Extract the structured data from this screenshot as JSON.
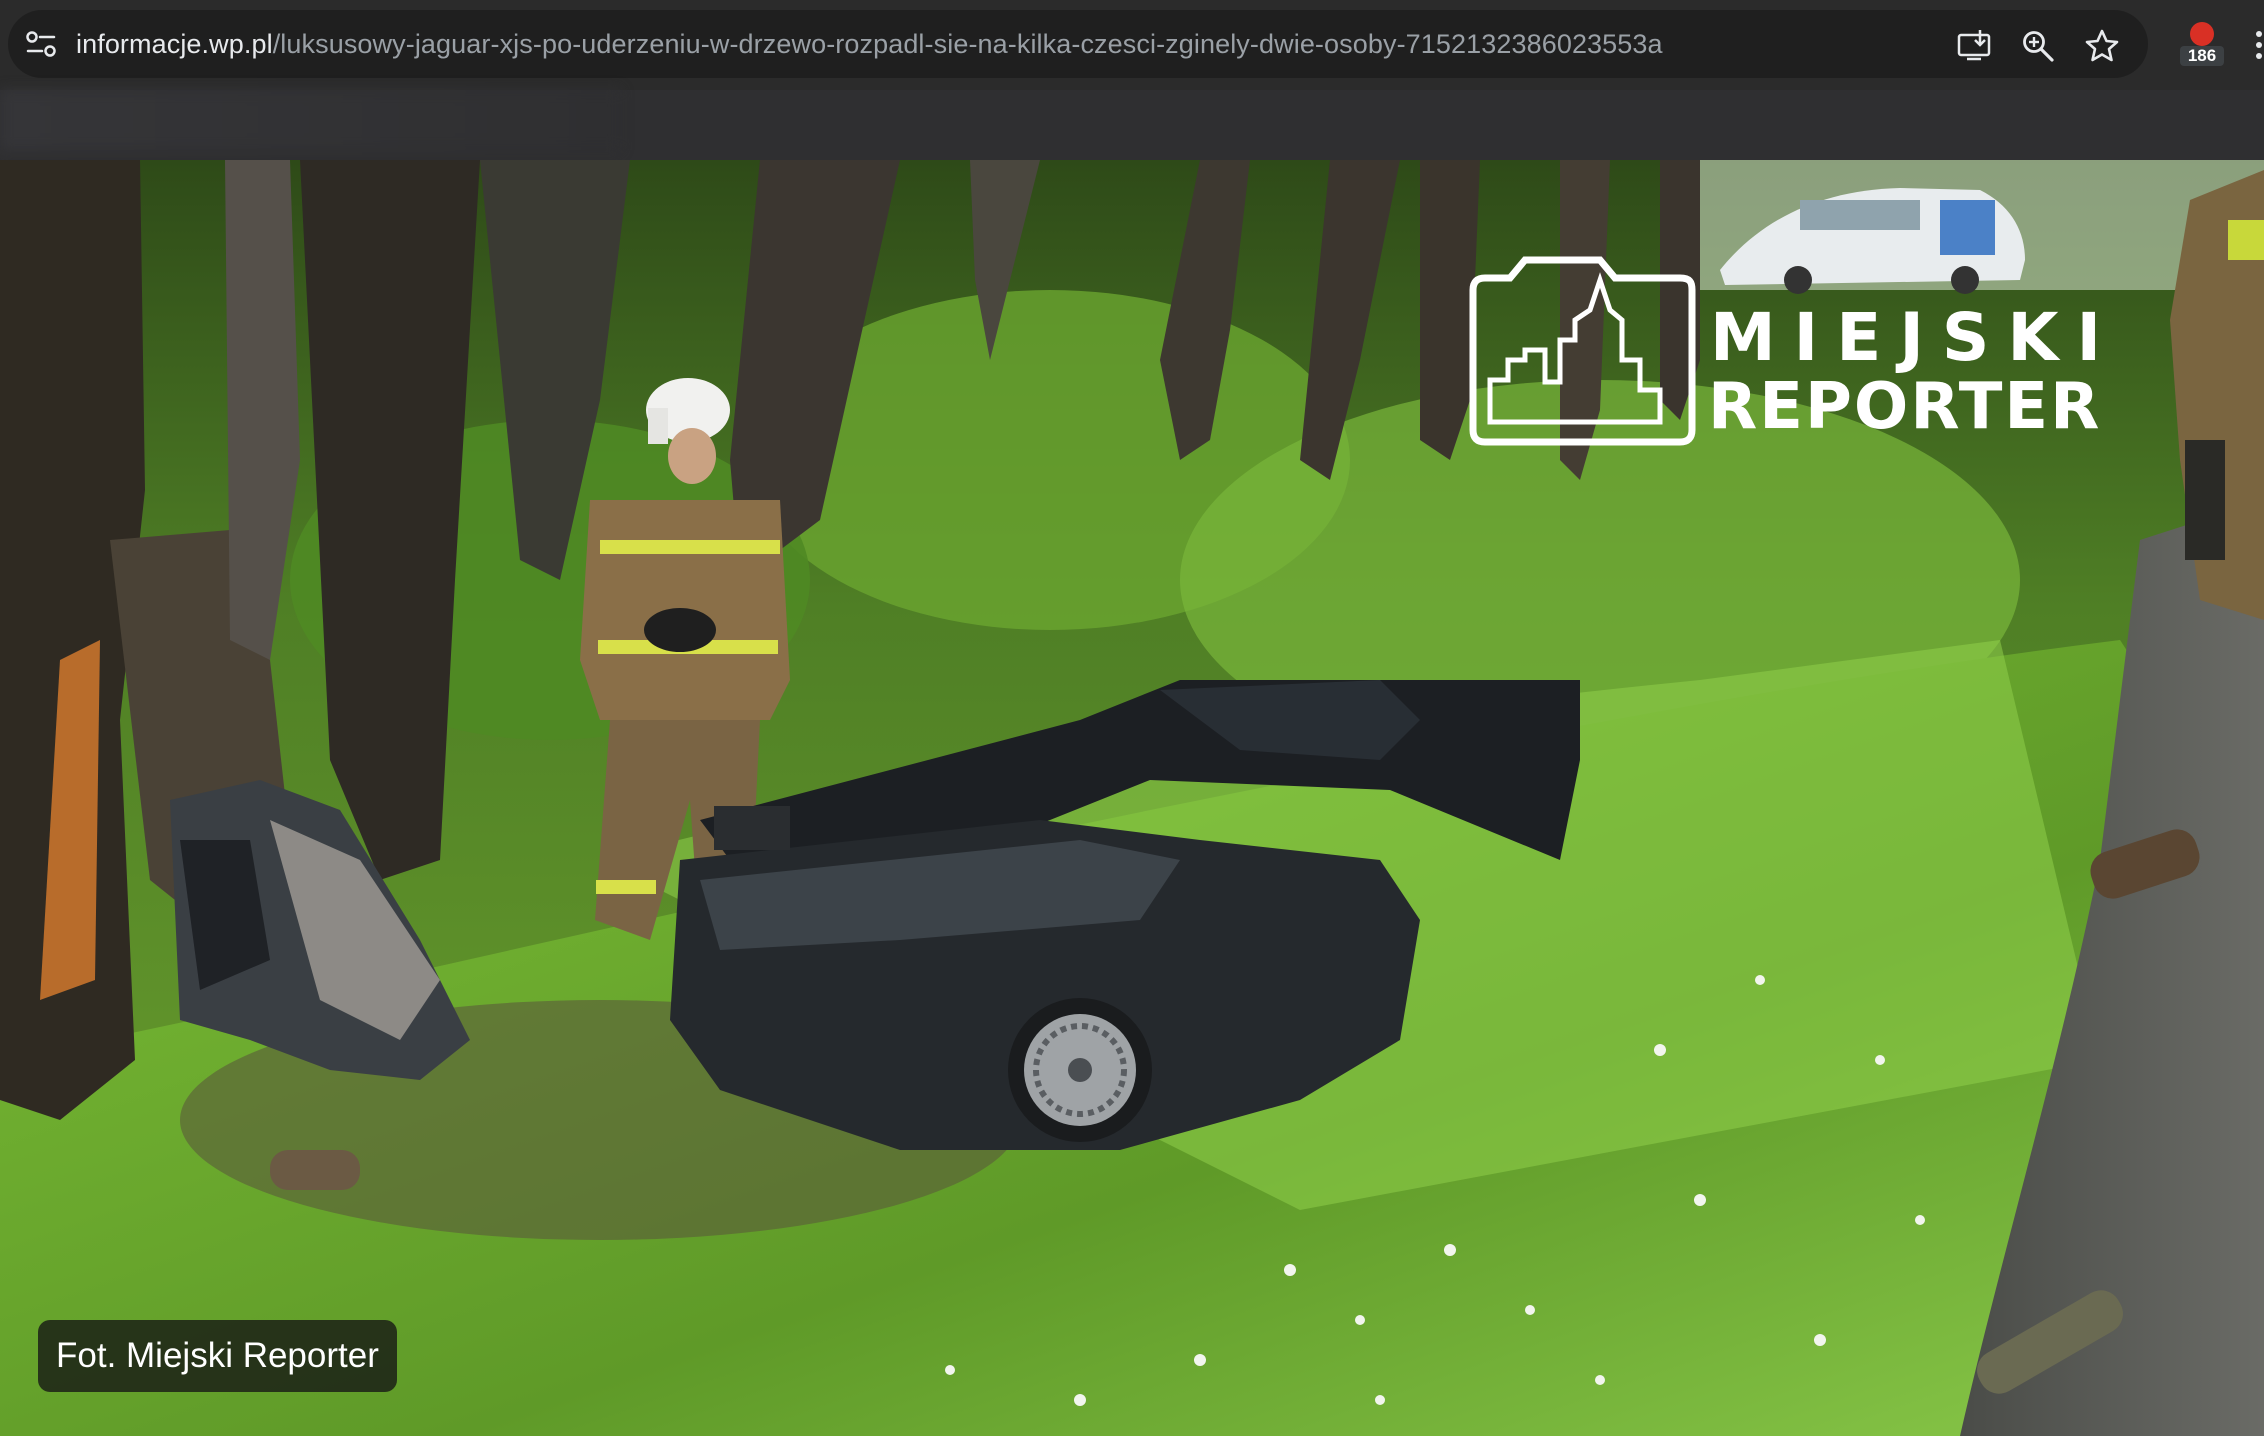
{
  "browser": {
    "url_host": "informacje.wp.pl",
    "url_path": "/luksusowy-jaguar-xjs-po-uderzeniu-w-drzewo-rozpadl-sie-na-kilka-czesci-zginely-dwie-osoby-7152132386023553a",
    "extension_badge_count": "186",
    "icons": [
      "site-info-icon",
      "install-app-icon",
      "zoom-icon",
      "bookmark-star-icon",
      "extension-icon",
      "more-icon"
    ]
  },
  "photo": {
    "watermark_line1": "MIEJSKI",
    "watermark_line2": "REPORTER",
    "caption": "Fot. Miejski Reporter"
  },
  "colors": {
    "chrome_bg": "#2b2b2b",
    "omnibox_bg": "#1f1f1f",
    "url_host": "#e8eaed",
    "url_path": "#9aa0a6",
    "foliage": "#4e7a2a"
  }
}
